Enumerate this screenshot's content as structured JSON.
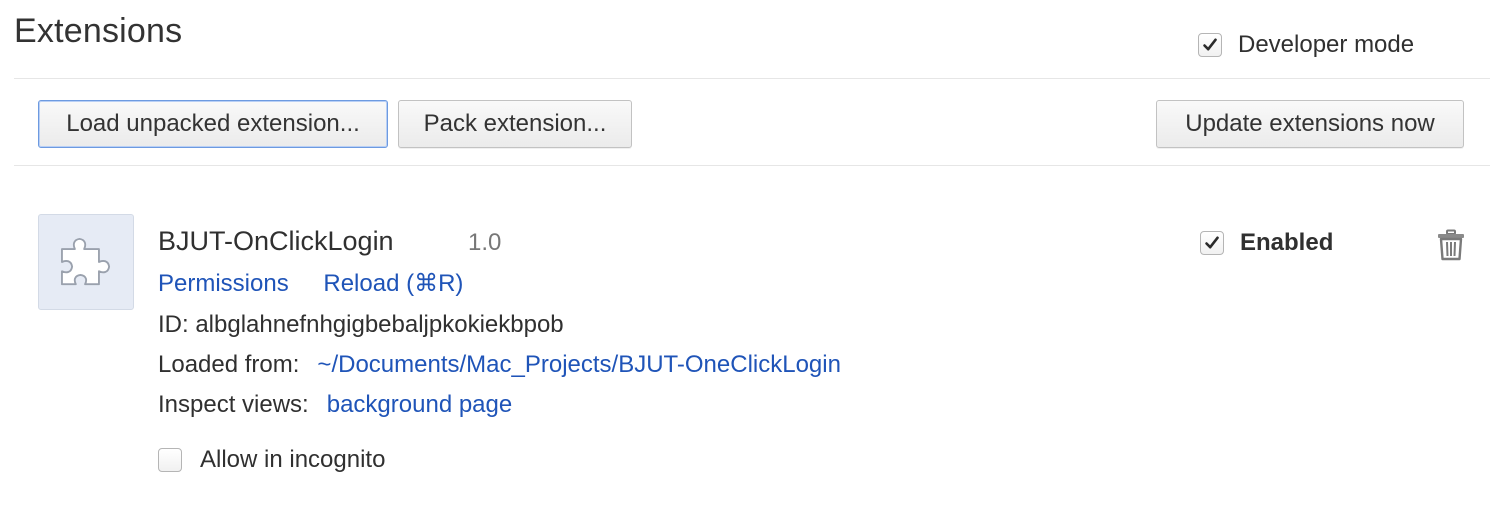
{
  "page": {
    "title": "Extensions"
  },
  "developer_mode": {
    "label": "Developer mode",
    "checked": true
  },
  "toolbar": {
    "load_unpacked_label": "Load unpacked extension...",
    "pack_label": "Pack extension...",
    "update_label": "Update extensions now"
  },
  "extension": {
    "name": "BJUT-OnClickLogin",
    "version": "1.0",
    "icon": "puzzle-piece-icon",
    "permissions_label": "Permissions",
    "reload_label": "Reload (⌘R)",
    "id_text": "ID: albglahnefnhgigbebaljpkokiekbpob",
    "loaded_from_label": "Loaded from:",
    "loaded_from_path": "~/Documents/Mac_Projects/BJUT-OneClickLogin",
    "inspect_views_label": "Inspect views:",
    "inspect_views_link": "background page",
    "enabled_label": "Enabled",
    "enabled_checked": true,
    "incognito_label": "Allow in incognito",
    "incognito_checked": false
  },
  "colors": {
    "link": "#1f54b8",
    "text": "#303030",
    "focus_border": "#6d9ae0"
  }
}
